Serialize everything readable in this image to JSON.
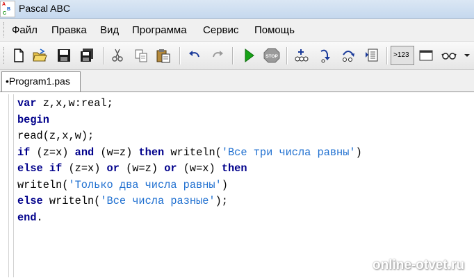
{
  "window": {
    "title": "Pascal ABC",
    "icon_letters": [
      "A",
      "B",
      "C"
    ]
  },
  "menu": {
    "items": [
      "Файл",
      "Правка",
      "Вид",
      "Программа",
      "Сервис",
      "Помощь"
    ]
  },
  "toolbar": {
    "icons": [
      "new-file-icon",
      "open-folder-icon",
      "save-icon",
      "save-all-icon",
      "cut-icon",
      "copy-icon",
      "paste-icon",
      "undo-icon",
      "redo-icon",
      "run-icon",
      "stop-icon",
      "step-icon",
      "step-into-icon",
      "step-over-icon",
      "watch-icon",
      "console-icon",
      "window-icon",
      "glasses-icon"
    ],
    "stop_label": "STOP",
    "console_label": ">123"
  },
  "tabs": [
    {
      "label": "•Program1.pas",
      "active": true
    }
  ],
  "editor": {
    "lines": [
      {
        "code": "var z,x,w:real;"
      },
      {
        "code": "begin"
      },
      {
        "code": "read(z,x,w);"
      },
      {
        "code": "if (z=x) and (w=z) then writeln('Все три числа равны')"
      },
      {
        "code": "else if (z=x) or (w=z) or (w=x) then"
      },
      {
        "code": "writeln('Только два числа равны')"
      },
      {
        "code": "else writeln('Все числа разные');"
      },
      {
        "code": "end."
      }
    ]
  },
  "watermark": "online-otvet.ru",
  "colors": {
    "keyword": "#00008b",
    "string": "#1e6fd0",
    "titlebar": "#c5d8ee"
  }
}
